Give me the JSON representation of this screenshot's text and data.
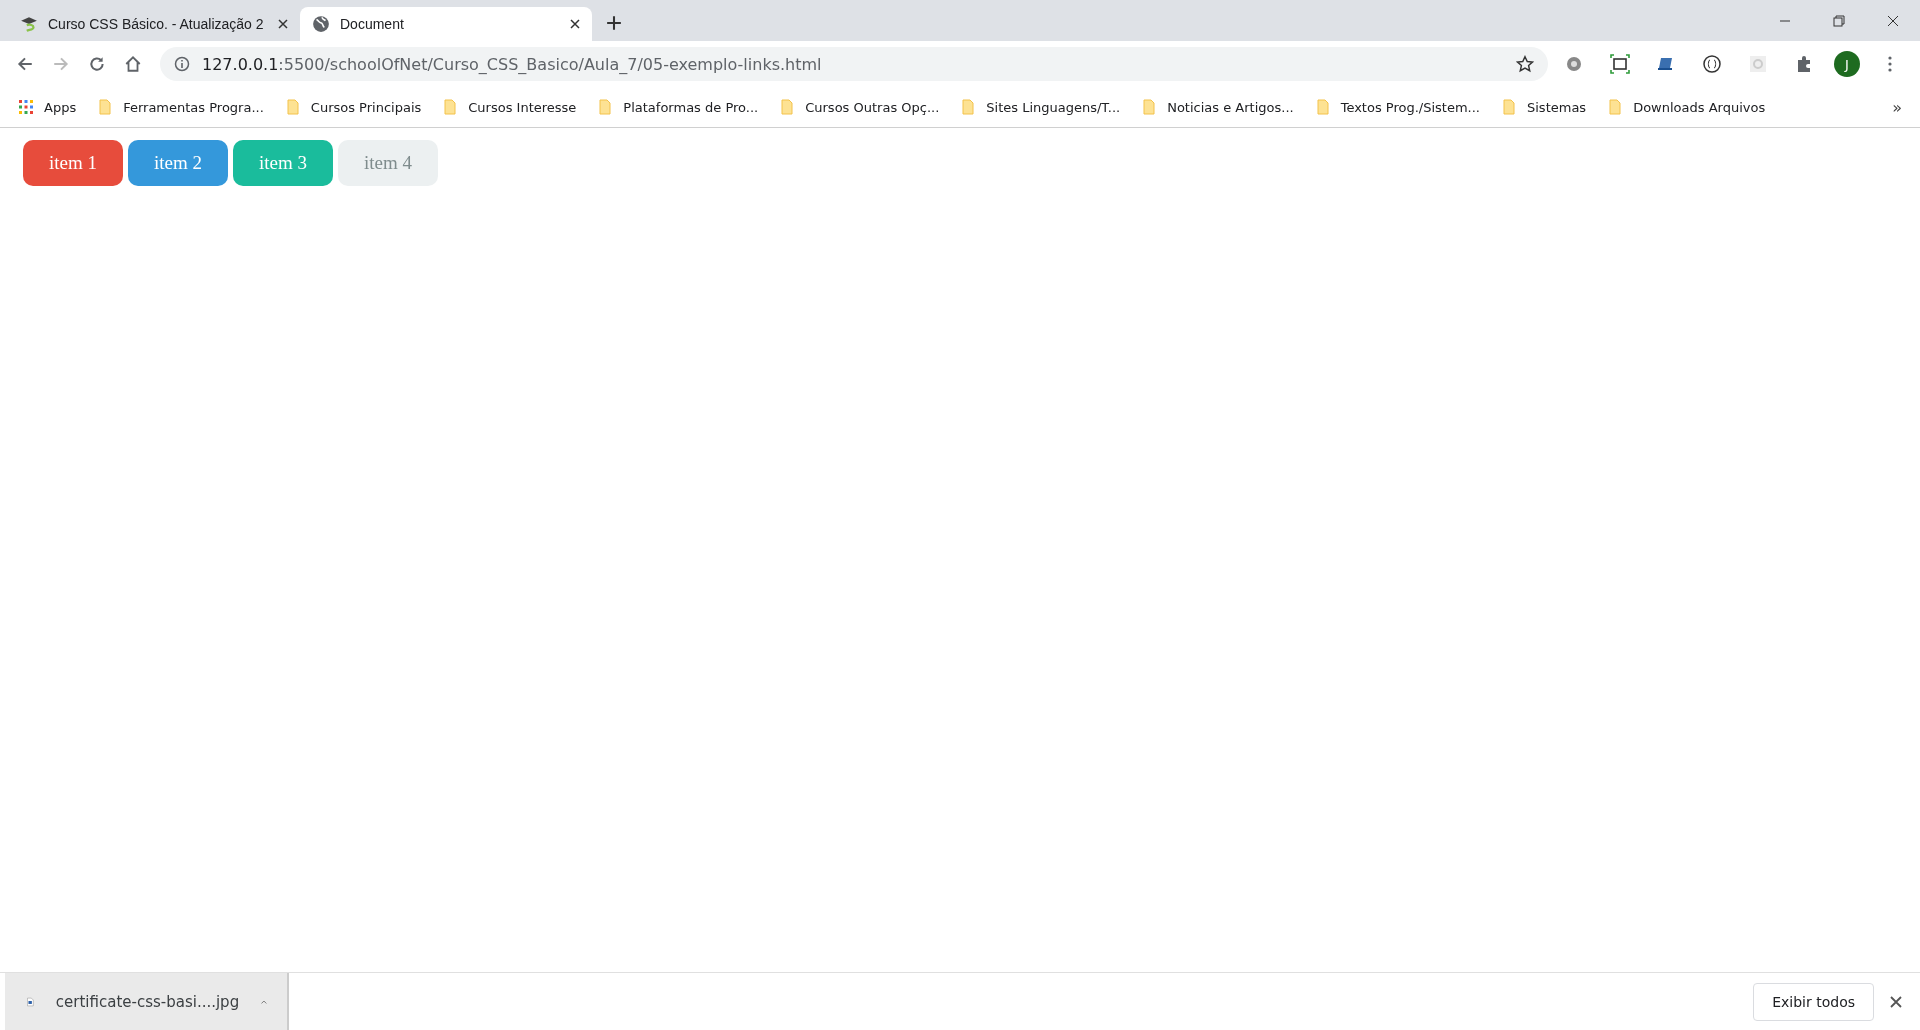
{
  "tabs": [
    {
      "title": "Curso CSS Básico. - Atualização 2",
      "kind": "course",
      "selected": false
    },
    {
      "title": "Document",
      "kind": "globe",
      "selected": true
    }
  ],
  "toolbar": {
    "url_host": "127.0.0.1",
    "url_path": ":5500/schoolOfNet/Curso_CSS_Basico/Aula_7/05-exemplo-links.html",
    "profile_initial": "J"
  },
  "bookmarks": {
    "apps": "Apps",
    "items": [
      "Ferramentas Progra...",
      "Cursos Principais",
      "Cursos Interesse",
      "Plataformas de Pro...",
      "Cursos Outras Opç...",
      "Sites Linguagens/T...",
      "Noticias e Artigos...",
      "Textos Prog./Sistem...",
      "Sistemas",
      "Downloads Arquivos"
    ],
    "more": "»"
  },
  "page": {
    "links": [
      {
        "label": "item 1",
        "color": "#e74c3c"
      },
      {
        "label": "item 2",
        "color": "#3498db"
      },
      {
        "label": "item 3",
        "color": "#1abc9c"
      },
      {
        "label": "item 4",
        "color": "#ecf0f1"
      }
    ]
  },
  "download_bar": {
    "file": "certificate-css-basi....jpg",
    "show_all": "Exibir todos"
  }
}
